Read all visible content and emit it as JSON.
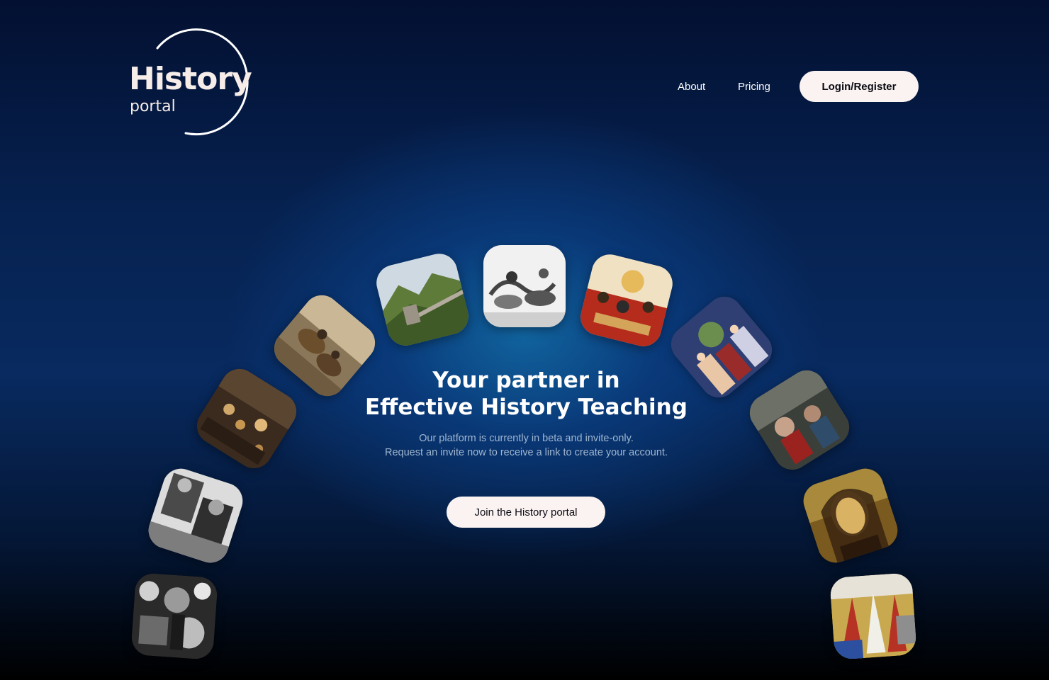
{
  "logo": {
    "title": "History",
    "subtitle": "portal"
  },
  "nav": {
    "about": "About",
    "pricing": "Pricing",
    "login": "Login/Register"
  },
  "hero": {
    "title_line1": "Your partner in",
    "title_line2": "Effective History Teaching",
    "sub_line1": "Our platform is currently in beta and invite-only.",
    "sub_line2": "Request an invite now to receive a link to create your account.",
    "cta": "Join the History portal"
  },
  "tiles": [
    {
      "name": "ww2-crowd-photo",
      "colors": [
        "#202020",
        "#cfcfcf",
        "#5a5a5a"
      ]
    },
    {
      "name": "ww2-officers-photo",
      "colors": [
        "#e9e9e9",
        "#3a3a3a",
        "#9c9c9c"
      ]
    },
    {
      "name": "roman-arena-painting",
      "colors": [
        "#3b2a1e",
        "#c9a067",
        "#6b4e2c"
      ]
    },
    {
      "name": "crusaders-painting",
      "colors": [
        "#6b5a43",
        "#c8b89a",
        "#8a6a45"
      ]
    },
    {
      "name": "great-wall-photo",
      "colors": [
        "#5f7b3a",
        "#cfd6cf",
        "#2f4a1e"
      ]
    },
    {
      "name": "cavalry-battle-engraving",
      "colors": [
        "#f2f2f2",
        "#555555",
        "#aaaaaa"
      ]
    },
    {
      "name": "asian-army-painting",
      "colors": [
        "#f0e2c0",
        "#b32c1c",
        "#d3a45a"
      ]
    },
    {
      "name": "medieval-nativity-painting",
      "colors": [
        "#2f3f73",
        "#e9c6a6",
        "#6b8e4e"
      ]
    },
    {
      "name": "renaissance-crowd-painting",
      "colors": [
        "#3b3f3a",
        "#c7a28a",
        "#9a2320"
      ]
    },
    {
      "name": "mona-lisa-painting",
      "colors": [
        "#b07d1c",
        "#3a2410",
        "#d9b263"
      ]
    },
    {
      "name": "procession-miniature",
      "colors": [
        "#c9a94f",
        "#b53225",
        "#e7e2d8"
      ]
    }
  ]
}
